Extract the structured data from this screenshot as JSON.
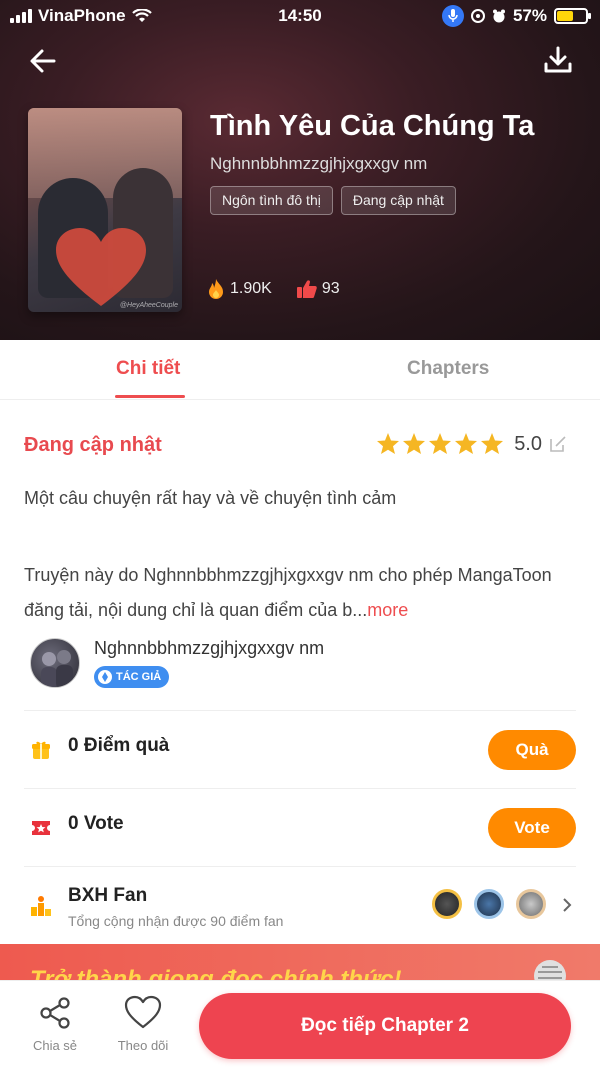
{
  "status_bar": {
    "carrier": "VinaPhone",
    "time": "14:50",
    "battery": "57%"
  },
  "book": {
    "title": "Tình Yêu Của Chúng Ta",
    "author": "Nghnnbbhmzzgjhjxgxxgv nm",
    "tags": [
      "Ngôn tình đô thị",
      "Đang cập nhật"
    ],
    "views": "1.90K",
    "likes": "93",
    "cover_watermark": "@HeyAheeCouple"
  },
  "tabs": [
    {
      "label": "Chi tiết",
      "active": true
    },
    {
      "label": "Chapters",
      "active": false
    }
  ],
  "detail": {
    "status": "Đang cập nhật",
    "rating": "5.0",
    "stars": 5,
    "description": "Một câu chuyện rất hay và về chuyện tình cảm",
    "notice": "Truyện này do Nghnnbbhmzzgjhjxgxxgv nm cho phép MangaToon đăng tải, nội dung chỉ là quan điểm của b...",
    "more_label": "more"
  },
  "author_card": {
    "name": "Nghnnbbhmzzgjhjxgxxgv nm",
    "badge": "TÁC GIẢ"
  },
  "rows": {
    "gift": {
      "label": "0 Điểm quà",
      "button": "Quà"
    },
    "vote": {
      "label": "0 Vote",
      "button": "Vote"
    },
    "fan": {
      "label": "BXH Fan",
      "sub": "Tổng cộng nhận được 90 điểm fan"
    }
  },
  "banner": {
    "text": "Trở thành giọng đọc chính thức!"
  },
  "bottom_bar": {
    "share_label": "Chia sẻ",
    "follow_label": "Theo dõi",
    "read_label": "Đọc tiếp Chapter 2"
  },
  "colors": {
    "accent": "#ee4d4f",
    "button_orange": "#ff8a00",
    "read_button": "#ee4450"
  }
}
